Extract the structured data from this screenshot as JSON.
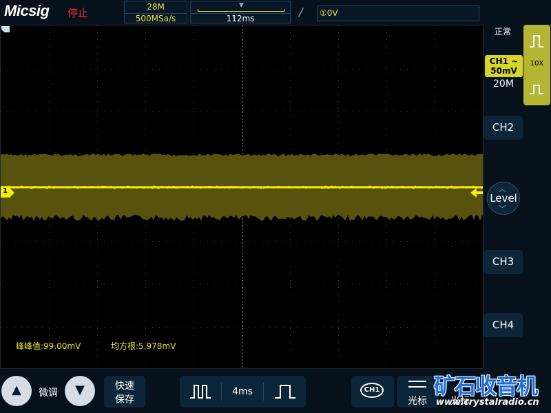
{
  "header": {
    "brand": "Micsig",
    "run_state": "停止",
    "memory_depth": "28M",
    "sample_rate": "500MSa/s",
    "time_position": "112ms",
    "trigger_edge_icon": "rising-edge-icon",
    "trigger_level": "①0V"
  },
  "screen": {
    "channel_marker": "1",
    "trace_color": "#f5f000",
    "measurements": {
      "peak_to_peak": "峰峰值:99.00mV",
      "rms": "均方根:5.978mV"
    }
  },
  "right_panel": {
    "acquisition_mode": "正常",
    "ch1_label": "CH1",
    "ch1_coupling_icon": "ac-coupling-icon",
    "ch1_scale": "50mV",
    "ch1_bandwidth": "20M",
    "probe_ratio": "10X",
    "ch2": "CH2",
    "level": "Level",
    "ch3": "CH3",
    "ch4": "CH4"
  },
  "bottom_bar": {
    "fine_adjust": "微调",
    "quick_save_line1": "快速",
    "quick_save_line2": "保存",
    "timebase": "4ms",
    "channel_select": "CH1",
    "cursor": "光标",
    "cursor2": "光标"
  },
  "watermark": {
    "title": "矿石收音机",
    "url": "www.crystalradio.cn"
  }
}
